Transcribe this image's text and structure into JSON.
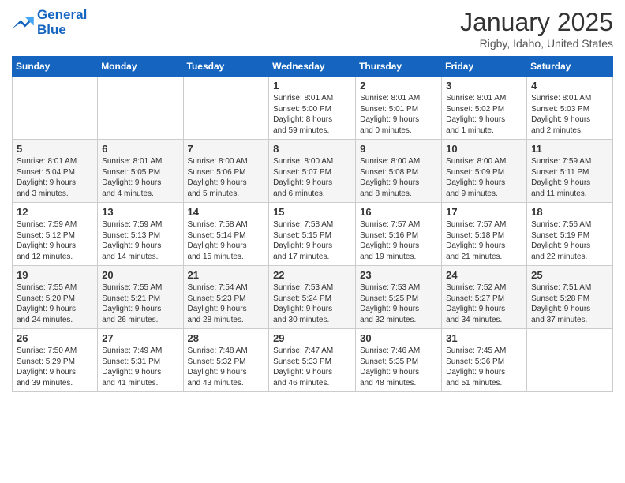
{
  "logo": {
    "line1": "General",
    "line2": "Blue"
  },
  "header": {
    "month": "January 2025",
    "location": "Rigby, Idaho, United States"
  },
  "weekdays": [
    "Sunday",
    "Monday",
    "Tuesday",
    "Wednesday",
    "Thursday",
    "Friday",
    "Saturday"
  ],
  "weeks": [
    [
      {
        "day": "",
        "content": ""
      },
      {
        "day": "",
        "content": ""
      },
      {
        "day": "",
        "content": ""
      },
      {
        "day": "1",
        "content": "Sunrise: 8:01 AM\nSunset: 5:00 PM\nDaylight: 8 hours\nand 59 minutes."
      },
      {
        "day": "2",
        "content": "Sunrise: 8:01 AM\nSunset: 5:01 PM\nDaylight: 9 hours\nand 0 minutes."
      },
      {
        "day": "3",
        "content": "Sunrise: 8:01 AM\nSunset: 5:02 PM\nDaylight: 9 hours\nand 1 minute."
      },
      {
        "day": "4",
        "content": "Sunrise: 8:01 AM\nSunset: 5:03 PM\nDaylight: 9 hours\nand 2 minutes."
      }
    ],
    [
      {
        "day": "5",
        "content": "Sunrise: 8:01 AM\nSunset: 5:04 PM\nDaylight: 9 hours\nand 3 minutes."
      },
      {
        "day": "6",
        "content": "Sunrise: 8:01 AM\nSunset: 5:05 PM\nDaylight: 9 hours\nand 4 minutes."
      },
      {
        "day": "7",
        "content": "Sunrise: 8:00 AM\nSunset: 5:06 PM\nDaylight: 9 hours\nand 5 minutes."
      },
      {
        "day": "8",
        "content": "Sunrise: 8:00 AM\nSunset: 5:07 PM\nDaylight: 9 hours\nand 6 minutes."
      },
      {
        "day": "9",
        "content": "Sunrise: 8:00 AM\nSunset: 5:08 PM\nDaylight: 9 hours\nand 8 minutes."
      },
      {
        "day": "10",
        "content": "Sunrise: 8:00 AM\nSunset: 5:09 PM\nDaylight: 9 hours\nand 9 minutes."
      },
      {
        "day": "11",
        "content": "Sunrise: 7:59 AM\nSunset: 5:11 PM\nDaylight: 9 hours\nand 11 minutes."
      }
    ],
    [
      {
        "day": "12",
        "content": "Sunrise: 7:59 AM\nSunset: 5:12 PM\nDaylight: 9 hours\nand 12 minutes."
      },
      {
        "day": "13",
        "content": "Sunrise: 7:59 AM\nSunset: 5:13 PM\nDaylight: 9 hours\nand 14 minutes."
      },
      {
        "day": "14",
        "content": "Sunrise: 7:58 AM\nSunset: 5:14 PM\nDaylight: 9 hours\nand 15 minutes."
      },
      {
        "day": "15",
        "content": "Sunrise: 7:58 AM\nSunset: 5:15 PM\nDaylight: 9 hours\nand 17 minutes."
      },
      {
        "day": "16",
        "content": "Sunrise: 7:57 AM\nSunset: 5:16 PM\nDaylight: 9 hours\nand 19 minutes."
      },
      {
        "day": "17",
        "content": "Sunrise: 7:57 AM\nSunset: 5:18 PM\nDaylight: 9 hours\nand 21 minutes."
      },
      {
        "day": "18",
        "content": "Sunrise: 7:56 AM\nSunset: 5:19 PM\nDaylight: 9 hours\nand 22 minutes."
      }
    ],
    [
      {
        "day": "19",
        "content": "Sunrise: 7:55 AM\nSunset: 5:20 PM\nDaylight: 9 hours\nand 24 minutes."
      },
      {
        "day": "20",
        "content": "Sunrise: 7:55 AM\nSunset: 5:21 PM\nDaylight: 9 hours\nand 26 minutes."
      },
      {
        "day": "21",
        "content": "Sunrise: 7:54 AM\nSunset: 5:23 PM\nDaylight: 9 hours\nand 28 minutes."
      },
      {
        "day": "22",
        "content": "Sunrise: 7:53 AM\nSunset: 5:24 PM\nDaylight: 9 hours\nand 30 minutes."
      },
      {
        "day": "23",
        "content": "Sunrise: 7:53 AM\nSunset: 5:25 PM\nDaylight: 9 hours\nand 32 minutes."
      },
      {
        "day": "24",
        "content": "Sunrise: 7:52 AM\nSunset: 5:27 PM\nDaylight: 9 hours\nand 34 minutes."
      },
      {
        "day": "25",
        "content": "Sunrise: 7:51 AM\nSunset: 5:28 PM\nDaylight: 9 hours\nand 37 minutes."
      }
    ],
    [
      {
        "day": "26",
        "content": "Sunrise: 7:50 AM\nSunset: 5:29 PM\nDaylight: 9 hours\nand 39 minutes."
      },
      {
        "day": "27",
        "content": "Sunrise: 7:49 AM\nSunset: 5:31 PM\nDaylight: 9 hours\nand 41 minutes."
      },
      {
        "day": "28",
        "content": "Sunrise: 7:48 AM\nSunset: 5:32 PM\nDaylight: 9 hours\nand 43 minutes."
      },
      {
        "day": "29",
        "content": "Sunrise: 7:47 AM\nSunset: 5:33 PM\nDaylight: 9 hours\nand 46 minutes."
      },
      {
        "day": "30",
        "content": "Sunrise: 7:46 AM\nSunset: 5:35 PM\nDaylight: 9 hours\nand 48 minutes."
      },
      {
        "day": "31",
        "content": "Sunrise: 7:45 AM\nSunset: 5:36 PM\nDaylight: 9 hours\nand 51 minutes."
      },
      {
        "day": "",
        "content": ""
      }
    ]
  ]
}
